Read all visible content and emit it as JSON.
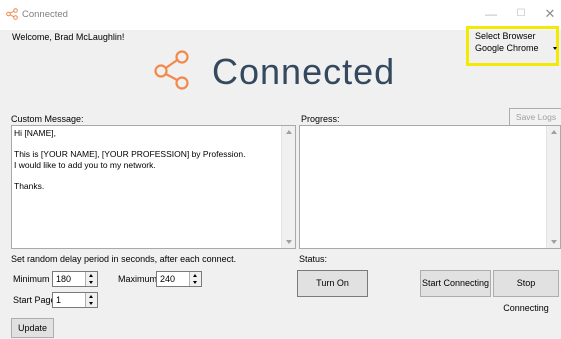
{
  "window": {
    "title": "Connected"
  },
  "header": {
    "welcome": "Welcome, Brad McLaughlin!",
    "logo_text": "Connected"
  },
  "browser": {
    "label": "Select Browser",
    "selected": "Google Chrome"
  },
  "custom_message": {
    "label": "Custom Message:",
    "text": "Hi [NAME],\n\nThis is [YOUR NAME], [YOUR PROFESSION] by Profession.\nI would like to add you to my network.\n\nThanks."
  },
  "progress": {
    "label": "Progress:",
    "save_logs": "Save Logs"
  },
  "delay": {
    "label": "Set random delay period in seconds, after each connect.",
    "minimum_label": "Minimum",
    "minimum_value": "180",
    "maximum_label": "Maximum",
    "maximum_value": "240",
    "start_page_label": "Start Page",
    "start_page_value": "1"
  },
  "status": {
    "label": "Status:"
  },
  "buttons": {
    "turn_on": "Turn On",
    "start_connecting": "Start Connecting",
    "stop_connecting": "Stop Connecting",
    "update": "Update"
  },
  "colors": {
    "highlight": "#f2ea04",
    "logo_icon": "#f2894b",
    "logo_text": "#34495e"
  },
  "icons": [
    "share-icon",
    "minimize-icon",
    "maximize-icon",
    "close-icon",
    "chevron-down-icon",
    "spinner-up-icon",
    "spinner-down-icon"
  ]
}
